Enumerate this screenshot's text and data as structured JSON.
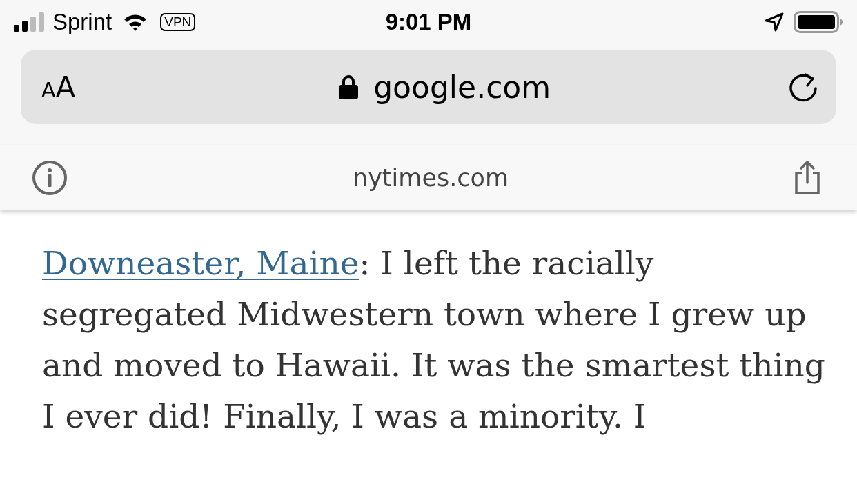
{
  "status_bar": {
    "carrier": "Sprint",
    "vpn": "VPN",
    "time": "9:01 PM"
  },
  "address_bar": {
    "text_size_button": "AA",
    "url": "google.com"
  },
  "site_bar": {
    "domain": "nytimes.com"
  },
  "article": {
    "paragraph": {
      "link": "Downeaster, Maine",
      "text": ": I left the racially segregated Midwestern town where I grew up and moved to Hawaii. It was the smartest thing I ever did! Finally, I was a minority. I"
    }
  }
}
